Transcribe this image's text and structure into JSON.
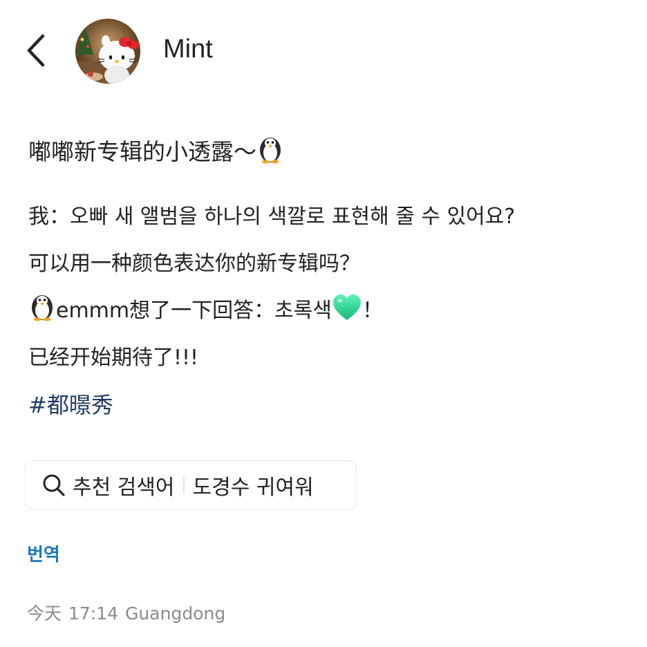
{
  "header": {
    "back_icon": "chevron-left-icon",
    "author_name": "Mint"
  },
  "post": {
    "title": "嘟嘟新专辑的小透露～",
    "line1": "我：오빠 새 앨범을 하나의 색깔로 표현해 줄 수 있어요?",
    "line2": "可以用一种颜色表达你的新专辑吗？",
    "line3_text": "emmm想了一下回答：초록색",
    "line3_end": "！",
    "line4": "已经开始期待了!!!",
    "hashtag": "#都暻秀",
    "emoji_penguin": "penguin-emoji",
    "emoji_heart": "green-heart-emoji",
    "heart_color": "#2fd69a"
  },
  "search_suggestion": {
    "icon": "search-icon",
    "label": "추천 검색어",
    "term": "도경수 귀여워"
  },
  "footer": {
    "translate_label": "번역",
    "date": "今天",
    "time": "17:14",
    "location": "Guangdong"
  },
  "colors": {
    "hashtag": "#1f3c66",
    "link": "#1a78c2",
    "meta": "#8a8a8a"
  }
}
